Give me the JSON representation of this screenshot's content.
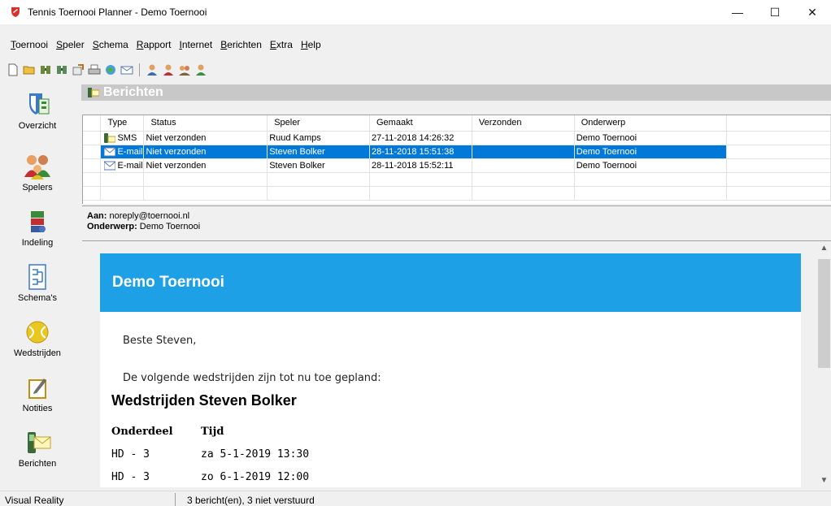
{
  "window": {
    "title": "Tennis Toernooi Planner - Demo Toernooi",
    "minimize": "—",
    "maximize": "☐",
    "close": "✕"
  },
  "menu": [
    {
      "first": "T",
      "rest": "oernooi"
    },
    {
      "first": "S",
      "rest": "peler"
    },
    {
      "first": "S",
      "rest": "chema"
    },
    {
      "first": "R",
      "rest": "apport"
    },
    {
      "first": "I",
      "rest": "nternet"
    },
    {
      "first": "B",
      "rest": "erichten"
    },
    {
      "first": "E",
      "rest": "xtra"
    },
    {
      "first": "H",
      "rest": "elp"
    }
  ],
  "sidebar": {
    "items": [
      {
        "label": "Overzicht"
      },
      {
        "label": "Spelers"
      },
      {
        "label": "Indeling"
      },
      {
        "label": "Schema's"
      },
      {
        "label": "Wedstrijden"
      },
      {
        "label": "Notities"
      },
      {
        "label": "Berichten"
      }
    ]
  },
  "panel": {
    "title": "Berichten"
  },
  "messages": {
    "columns": [
      "Type",
      "Status",
      "Speler",
      "Gemaakt",
      "Verzonden",
      "Onderwerp"
    ],
    "rows": [
      {
        "type": "SMS",
        "status": "Niet verzonden",
        "player": "Ruud Kamps",
        "created": "27-11-2018 14:26:32",
        "sent": "",
        "subject": "Demo Toernooi",
        "selected": false
      },
      {
        "type": "E-mail",
        "status": "Niet verzonden",
        "player": "Steven Bolker",
        "created": "28-11-2018 15:51:38",
        "sent": "",
        "subject": "Demo Toernooi",
        "selected": true
      },
      {
        "type": "E-mail",
        "status": "Niet verzonden",
        "player": "Steven Bolker",
        "created": "28-11-2018 15:52:11",
        "sent": "",
        "subject": "Demo Toernooi",
        "selected": false
      }
    ]
  },
  "header": {
    "to_label": "Aan:",
    "to_value": "noreply@toernooi.nl",
    "subject_label": "Onderwerp:",
    "subject_value": "Demo Toernooi"
  },
  "mail": {
    "banner": "Demo Toernooi",
    "greeting": "Beste Steven,",
    "intro": "De volgende wedstrijden zijn tot nu toe gepland:",
    "heading": "Wedstrijden Steven Bolker",
    "table_headers": [
      "Onderdeel",
      "Tijd"
    ],
    "matches": [
      {
        "event": "HD - 3",
        "time": "za 5-1-2019 13:30"
      },
      {
        "event": "HD - 3",
        "time": "zo 6-1-2019 12:00"
      }
    ]
  },
  "status": {
    "left": "Visual Reality",
    "right": "3 bericht(en), 3 niet verstuurd"
  },
  "colors": {
    "selection": "#0078d7",
    "banner": "#1ea0e6",
    "panel_header": "#c8c8c8"
  }
}
